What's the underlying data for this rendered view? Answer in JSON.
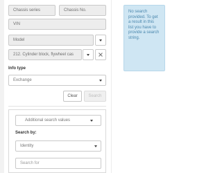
{
  "form": {
    "chassis_series_placeholder": "Chassis series",
    "chassis_no_placeholder": "Chassis No.",
    "vin_placeholder": "VIN",
    "model_value": "Model",
    "component_value": "212. Cylinder block, flywheel cas",
    "info_type_label": "Info type",
    "info_type_value": "Exchange",
    "clear_label": "Clear",
    "search_label": "Search"
  },
  "additional": {
    "toggle_label": "Additional search values",
    "search_by_label": "Search by:",
    "search_by_value": "Identity",
    "search_for_placeholder": "Search for"
  },
  "info": {
    "message": "No search provided. To get a result in this list you have to provide a search string."
  },
  "colors": {
    "info_bg": "#cfe6f3",
    "info_text": "#4a87ad",
    "filled_field_bg": "#ededed"
  }
}
